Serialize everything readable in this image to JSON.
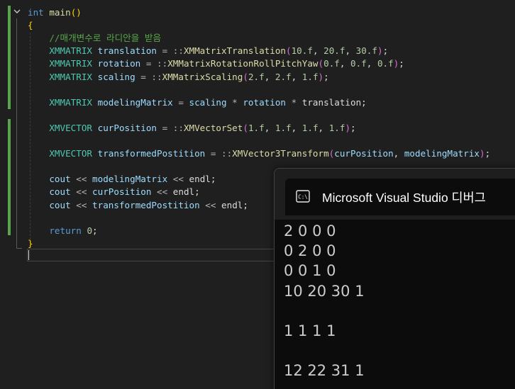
{
  "editor": {
    "lines": [
      [
        {
          "t": "int",
          "c": "kw"
        },
        {
          "t": " ",
          "c": "tx"
        },
        {
          "t": "main",
          "c": "fn"
        },
        {
          "t": "()",
          "c": "br"
        }
      ],
      [
        {
          "t": "{",
          "c": "br"
        }
      ],
      [
        {
          "t": "    //매개변수로 라디안을 받음",
          "c": "cm"
        }
      ],
      [
        {
          "t": "    ",
          "c": "tx"
        },
        {
          "t": "XMMATRIX",
          "c": "ty"
        },
        {
          "t": " ",
          "c": "tx"
        },
        {
          "t": "translation",
          "c": "var"
        },
        {
          "t": " = ::",
          "c": "op"
        },
        {
          "t": "XMMatrixTranslation",
          "c": "fn"
        },
        {
          "t": "(",
          "c": "br2"
        },
        {
          "t": "10.f",
          "c": "num"
        },
        {
          "t": ", ",
          "c": "tx"
        },
        {
          "t": "20.f",
          "c": "num"
        },
        {
          "t": ", ",
          "c": "tx"
        },
        {
          "t": "30.f",
          "c": "num"
        },
        {
          "t": ")",
          "c": "br2"
        },
        {
          "t": ";",
          "c": "tx"
        }
      ],
      [
        {
          "t": "    ",
          "c": "tx"
        },
        {
          "t": "XMMATRIX",
          "c": "ty"
        },
        {
          "t": " ",
          "c": "tx"
        },
        {
          "t": "rotation",
          "c": "var"
        },
        {
          "t": " = ::",
          "c": "op"
        },
        {
          "t": "XMMatrixRotationRollPitchYaw",
          "c": "fn"
        },
        {
          "t": "(",
          "c": "br2"
        },
        {
          "t": "0.f",
          "c": "num"
        },
        {
          "t": ", ",
          "c": "tx"
        },
        {
          "t": "0.f",
          "c": "num"
        },
        {
          "t": ", ",
          "c": "tx"
        },
        {
          "t": "0.f",
          "c": "num"
        },
        {
          "t": ")",
          "c": "br2"
        },
        {
          "t": ";",
          "c": "tx"
        }
      ],
      [
        {
          "t": "    ",
          "c": "tx"
        },
        {
          "t": "XMMATRIX",
          "c": "ty"
        },
        {
          "t": " ",
          "c": "tx"
        },
        {
          "t": "scaling",
          "c": "var"
        },
        {
          "t": " = ::",
          "c": "op"
        },
        {
          "t": "XMMatrixScaling",
          "c": "fn"
        },
        {
          "t": "(",
          "c": "br2"
        },
        {
          "t": "2.f",
          "c": "num"
        },
        {
          "t": ", ",
          "c": "tx"
        },
        {
          "t": "2.f",
          "c": "num"
        },
        {
          "t": ", ",
          "c": "tx"
        },
        {
          "t": "1.f",
          "c": "num"
        },
        {
          "t": ")",
          "c": "br2"
        },
        {
          "t": ";",
          "c": "tx"
        }
      ],
      [],
      [
        {
          "t": "    ",
          "c": "tx"
        },
        {
          "t": "XMMATRIX",
          "c": "ty"
        },
        {
          "t": " ",
          "c": "tx"
        },
        {
          "t": "modelingMatrix",
          "c": "var"
        },
        {
          "t": " = ",
          "c": "op"
        },
        {
          "t": "scaling",
          "c": "var"
        },
        {
          "t": " * ",
          "c": "op"
        },
        {
          "t": "rotation",
          "c": "var"
        },
        {
          "t": " * ",
          "c": "op"
        },
        {
          "t": "translation",
          "c": "tx"
        },
        {
          "t": ";",
          "c": "tx"
        }
      ],
      [],
      [
        {
          "t": "    ",
          "c": "tx"
        },
        {
          "t": "XMVECTOR",
          "c": "ty"
        },
        {
          "t": " ",
          "c": "tx"
        },
        {
          "t": "curPosition",
          "c": "var"
        },
        {
          "t": " = ::",
          "c": "op"
        },
        {
          "t": "XMVectorSet",
          "c": "fn"
        },
        {
          "t": "(",
          "c": "br2"
        },
        {
          "t": "1.f",
          "c": "num"
        },
        {
          "t": ", ",
          "c": "tx"
        },
        {
          "t": "1.f",
          "c": "num"
        },
        {
          "t": ", ",
          "c": "tx"
        },
        {
          "t": "1.f",
          "c": "num"
        },
        {
          "t": ", ",
          "c": "tx"
        },
        {
          "t": "1.f",
          "c": "num"
        },
        {
          "t": ")",
          "c": "br2"
        },
        {
          "t": ";",
          "c": "tx"
        }
      ],
      [],
      [
        {
          "t": "    ",
          "c": "tx"
        },
        {
          "t": "XMVECTOR",
          "c": "ty"
        },
        {
          "t": " ",
          "c": "tx"
        },
        {
          "t": "transformedPostition",
          "c": "var"
        },
        {
          "t": " = ::",
          "c": "op"
        },
        {
          "t": "XMVector3Transform",
          "c": "fn"
        },
        {
          "t": "(",
          "c": "br2"
        },
        {
          "t": "curPosition",
          "c": "var"
        },
        {
          "t": ", ",
          "c": "tx"
        },
        {
          "t": "modelingMatrix",
          "c": "var"
        },
        {
          "t": ")",
          "c": "br2"
        },
        {
          "t": ";",
          "c": "tx"
        }
      ],
      [],
      [
        {
          "t": "    ",
          "c": "tx"
        },
        {
          "t": "cout",
          "c": "var"
        },
        {
          "t": " << ",
          "c": "op"
        },
        {
          "t": "modelingMatrix",
          "c": "var"
        },
        {
          "t": " << ",
          "c": "op"
        },
        {
          "t": "endl",
          "c": "tx"
        },
        {
          "t": ";",
          "c": "tx"
        }
      ],
      [
        {
          "t": "    ",
          "c": "tx"
        },
        {
          "t": "cout",
          "c": "var"
        },
        {
          "t": " << ",
          "c": "op"
        },
        {
          "t": "curPosition",
          "c": "var"
        },
        {
          "t": " << ",
          "c": "op"
        },
        {
          "t": "endl",
          "c": "tx"
        },
        {
          "t": ";",
          "c": "tx"
        }
      ],
      [
        {
          "t": "    ",
          "c": "tx"
        },
        {
          "t": "cout",
          "c": "var"
        },
        {
          "t": " << ",
          "c": "op"
        },
        {
          "t": "transformedPostition",
          "c": "var"
        },
        {
          "t": " << ",
          "c": "op"
        },
        {
          "t": "endl",
          "c": "tx"
        },
        {
          "t": ";",
          "c": "tx"
        }
      ],
      [],
      [
        {
          "t": "    ",
          "c": "tx"
        },
        {
          "t": "return",
          "c": "kw"
        },
        {
          "t": " ",
          "c": "tx"
        },
        {
          "t": "0",
          "c": "num"
        },
        {
          "t": ";",
          "c": "tx"
        }
      ],
      [
        {
          "t": "}",
          "c": "br"
        }
      ]
    ]
  },
  "console": {
    "title": "Microsoft Visual Studio 디버그",
    "icon": "terminal-icon",
    "output": [
      "2 0 0 0",
      "0 2 0 0",
      "0 0 1 0",
      "10 20 30 1",
      "",
      "1 1 1 1",
      "",
      "12 22 31 1"
    ]
  },
  "colors": {
    "background": "#1f1f1f",
    "change_bar": "#57a64a",
    "keyword": "#569cd6",
    "function": "#dcdcaa",
    "type": "#4ec9b0",
    "variable": "#9cdcfe",
    "number": "#b5cea8",
    "comment": "#57a64a",
    "console_bg": "#0c0c0c"
  }
}
